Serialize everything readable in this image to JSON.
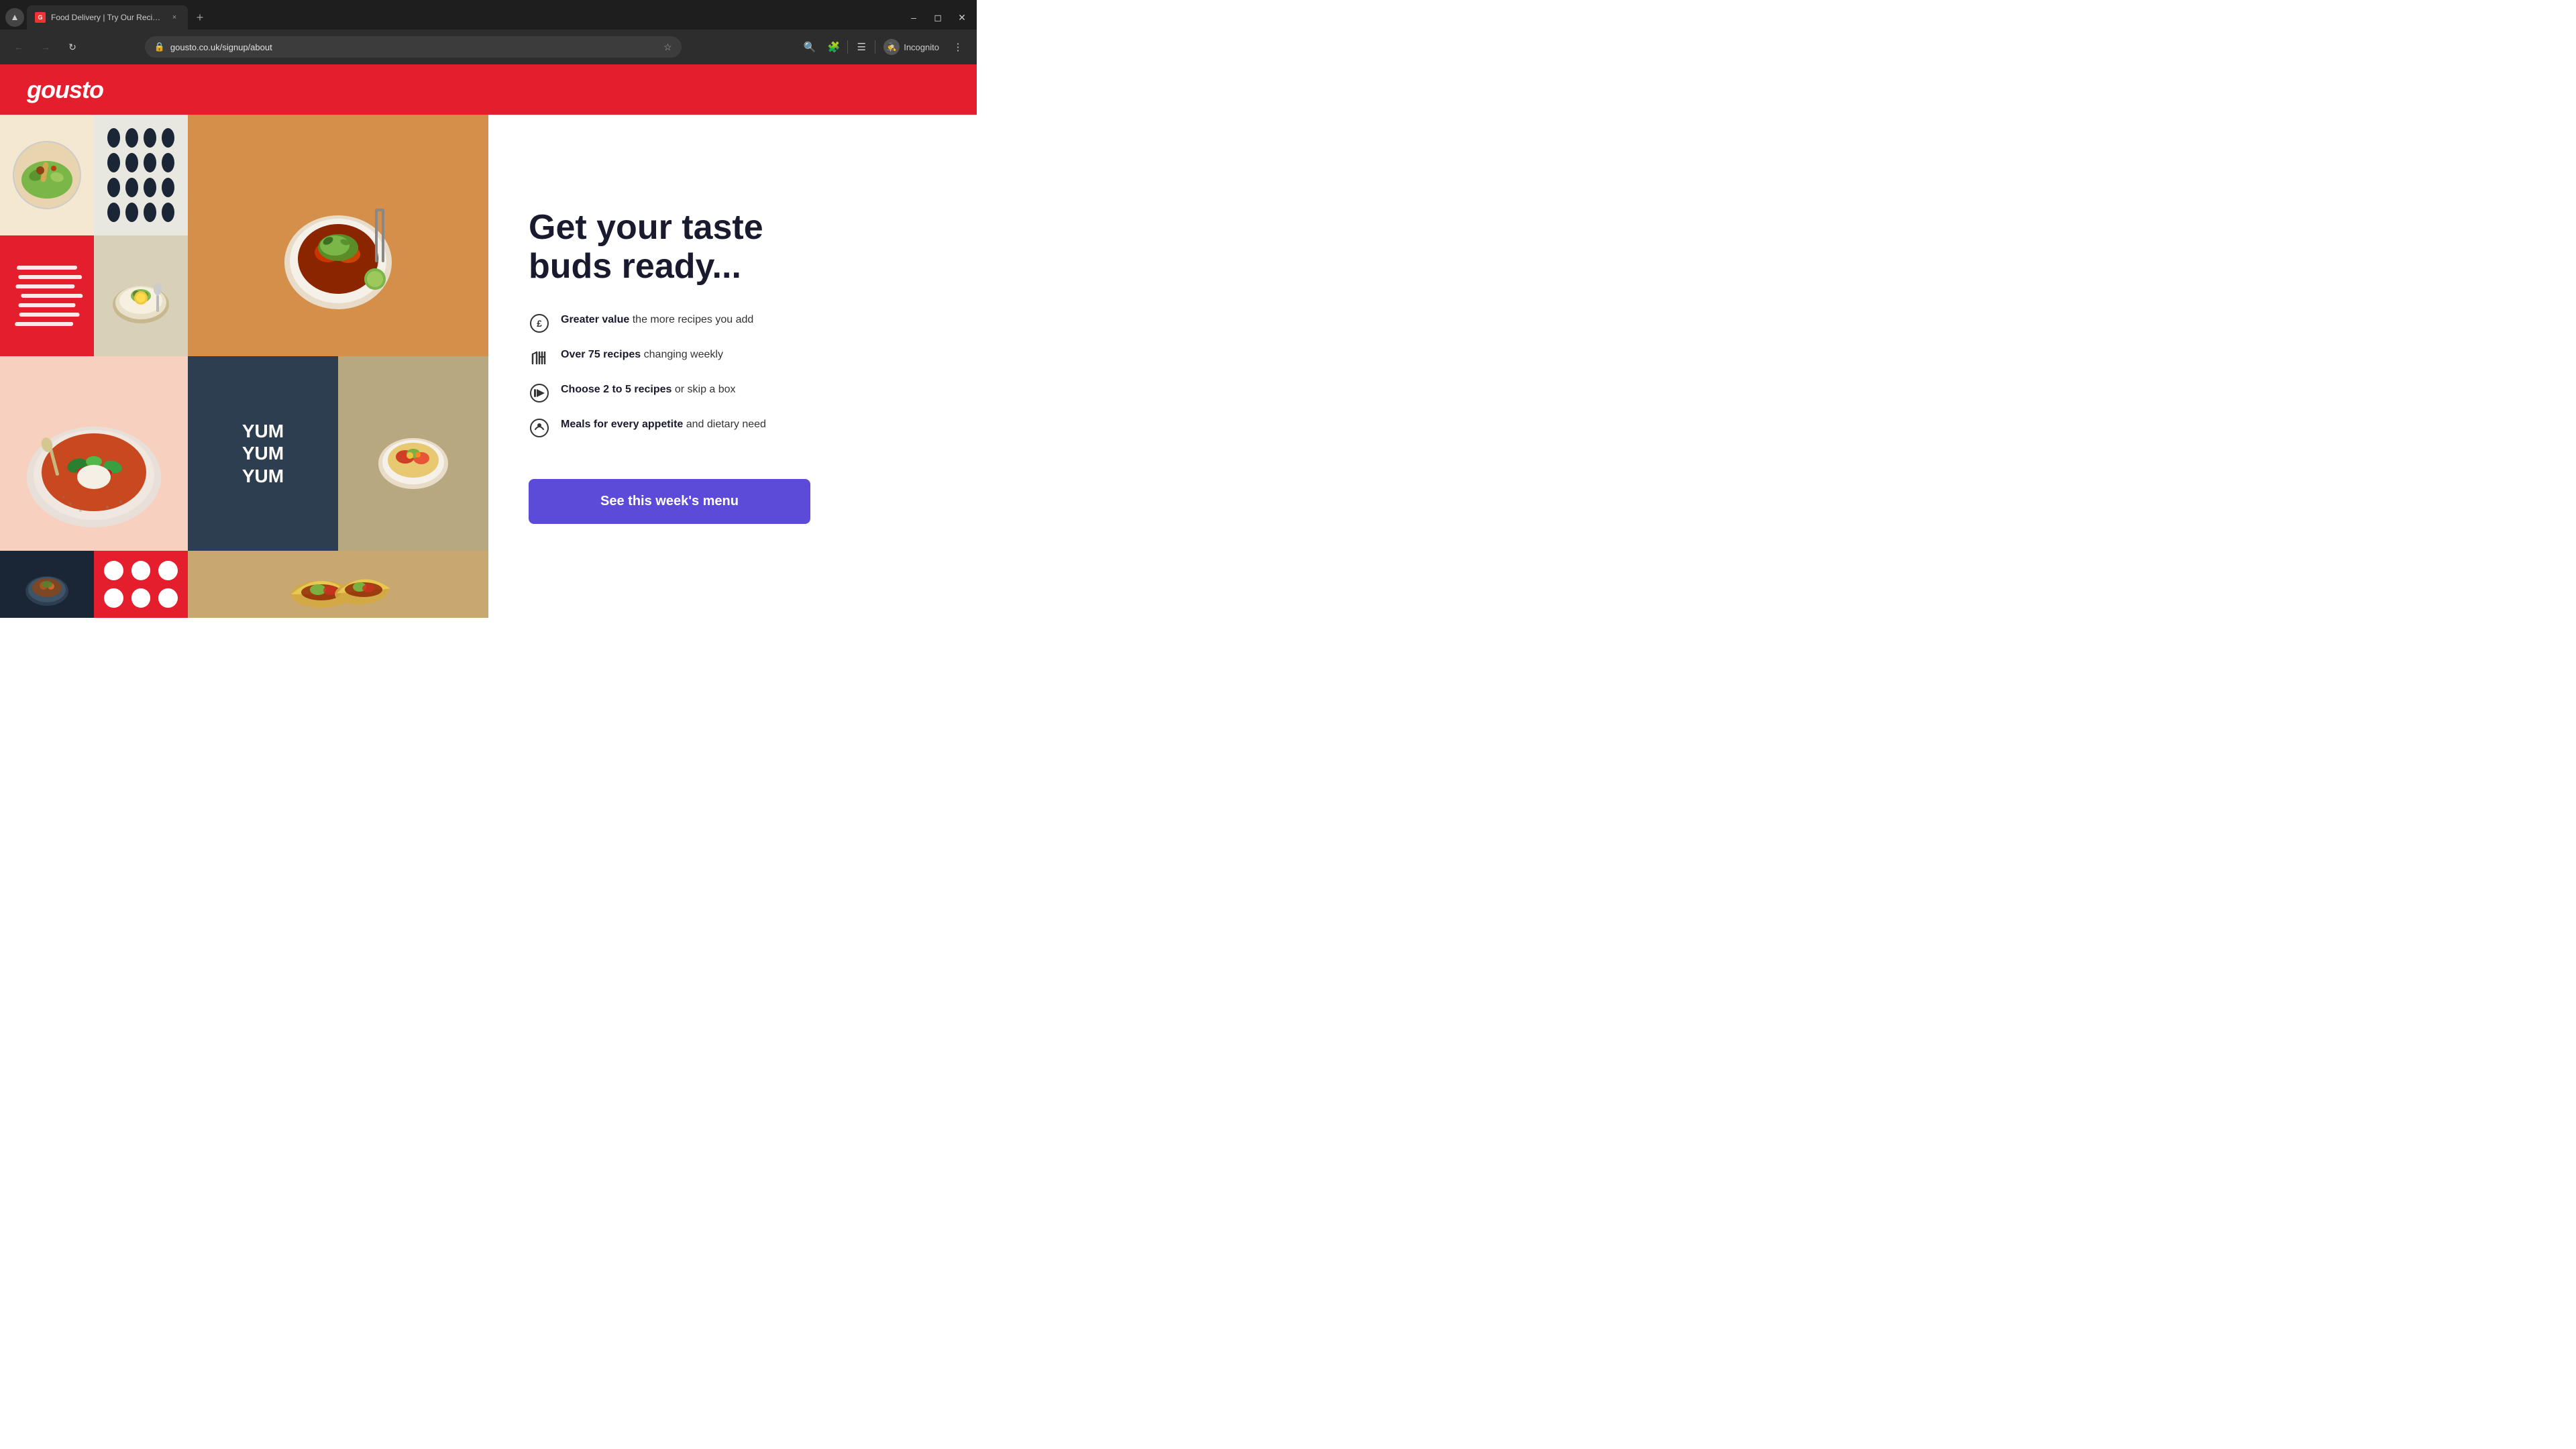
{
  "browser": {
    "tab_title": "Food Delivery | Try Our Recipe ...",
    "tab_favicon_letter": "G",
    "url": "gousto.co.uk/signup/about",
    "incognito_label": "Incognito"
  },
  "site": {
    "logo": "gousto"
  },
  "hero": {
    "headline_line1": "Get your taste",
    "headline_line2": "buds ready..."
  },
  "features": [
    {
      "icon": "£",
      "bold": "Greater value",
      "rest": " the more recipes you add"
    },
    {
      "icon": "🍴",
      "bold": "Over 75 recipes",
      "rest": " changing weekly"
    },
    {
      "icon": "⏩",
      "bold": "Choose 2 to 5 recipes",
      "rest": " or skip a box"
    },
    {
      "icon": "🌿",
      "bold": "Meals for every appetite",
      "rest": " and dietary need"
    }
  ],
  "cta": {
    "label": "See this week's menu"
  },
  "grid_tiles": {
    "yum_text": "YUM\nYUM\nYUM"
  },
  "colors": {
    "brand_red": "#e41e2d",
    "cta_purple": "#5c4bd8",
    "dark_navy": "#2c3e50"
  }
}
